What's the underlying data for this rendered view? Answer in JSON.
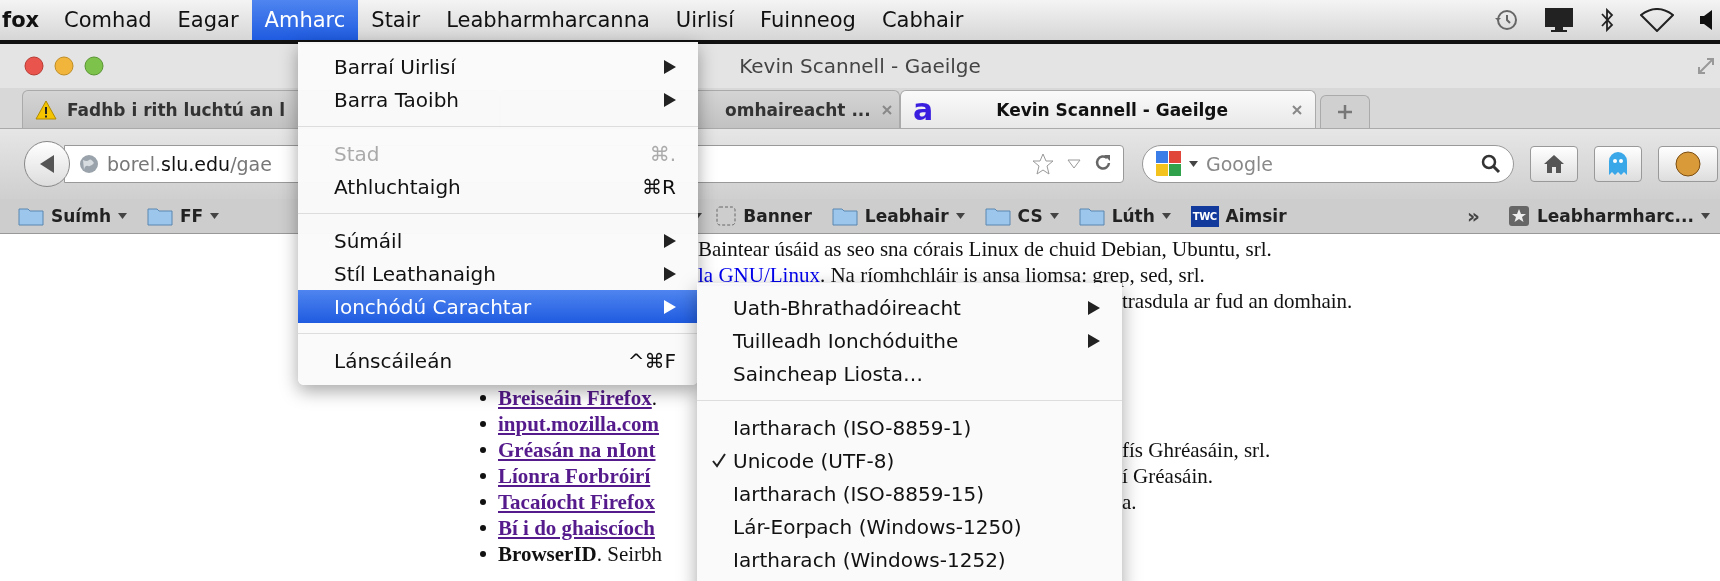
{
  "menubar": {
    "app": "fox",
    "items": [
      {
        "label": "Comhad",
        "selected": false
      },
      {
        "label": "Eagar",
        "selected": false
      },
      {
        "label": "Amharc",
        "selected": true
      },
      {
        "label": "Stair",
        "selected": false
      },
      {
        "label": "Leabharmharcanna",
        "selected": false
      },
      {
        "label": "Uirlisí",
        "selected": false
      },
      {
        "label": "Fuinneog",
        "selected": false
      },
      {
        "label": "Cabhair",
        "selected": false
      }
    ]
  },
  "window": {
    "title": "Kevin Scannell - Gaeilge"
  },
  "tabs": [
    {
      "kind": "warning",
      "label": "Fadhb i rith luchtú an l",
      "selected": false
    },
    {
      "kind": "plain",
      "label": "omhaireacht ...",
      "selected": false,
      "close_button": true
    },
    {
      "kind": "favicon",
      "favicon": "a",
      "label": "Kevin Scannell - Gaeilge",
      "selected": true,
      "close_button": true
    }
  ],
  "toolbar": {
    "url": "borel.**slu.edu**/gae",
    "search_placeholder": "Google"
  },
  "bookmarks": [
    {
      "kind": "folder",
      "label": "Suímh"
    },
    {
      "kind": "folder",
      "label": "FF"
    },
    {
      "kind": "caret"
    },
    {
      "kind": "placeholder",
      "label": "Banner"
    },
    {
      "kind": "folder",
      "label": "Leabhair"
    },
    {
      "kind": "folder",
      "label": "CS"
    },
    {
      "kind": "folder",
      "label": "Lúth"
    },
    {
      "kind": "site",
      "badge": "TWC",
      "label": "Aimsir"
    }
  ],
  "bookmarks_overflow": "»",
  "bookmarks_menu": {
    "label": "Leabharmharc..."
  },
  "page": {
    "intro": [
      {
        "text": "Baintear úsáid as seo sna córais Linux de chuid Debian, Ubuntu, srl."
      },
      {
        "link": "la GNU/Linux",
        "text": ". Na ríomhchláir is ansa liomsa: grep, sed, srl."
      },
      {
        "tail": "trasdula ar fud an domhain."
      }
    ],
    "list": [
      {
        "kind": "link",
        "link": "Breiseáin Firefox",
        "text": "."
      },
      {
        "kind": "link",
        "link": "input.mozilla.com"
      },
      {
        "kind": "link",
        "link": "Gréasán na nIont",
        "tail": "fís Ghréasáin, srl."
      },
      {
        "kind": "link",
        "link": "Líonra Forbróirí",
        "tail": "í Gréasáin."
      },
      {
        "kind": "link",
        "link": "Tacaíocht Firefox",
        "tail": "a."
      },
      {
        "kind": "link",
        "link": "Bí i do ghaiscíoch"
      },
      {
        "kind": "text",
        "text": "**BrowserID**. Seirbh"
      }
    ]
  },
  "menu": {
    "items": [
      {
        "kind": "item",
        "label": "Barraí Uirlisí",
        "submenu": true,
        "disabled": false,
        "selected": false
      },
      {
        "kind": "item",
        "label": "Barra Taoibh",
        "submenu": true,
        "disabled": false,
        "selected": false
      },
      {
        "kind": "separator"
      },
      {
        "kind": "item",
        "label": "Stad",
        "shortcut": "⌘.",
        "submenu": false,
        "disabled": true,
        "selected": false
      },
      {
        "kind": "item",
        "label": "Athluchtaigh",
        "shortcut": "⌘R",
        "submenu": false,
        "disabled": false,
        "selected": false
      },
      {
        "kind": "separator"
      },
      {
        "kind": "item",
        "label": "Súmáil",
        "submenu": true,
        "disabled": false,
        "selected": false
      },
      {
        "kind": "item",
        "label": "Stíl Leathanaigh",
        "submenu": true,
        "disabled": false,
        "selected": false
      },
      {
        "kind": "item",
        "label": "Ionchódú Carachtar",
        "submenu": true,
        "disabled": false,
        "selected": true
      },
      {
        "kind": "separator"
      },
      {
        "kind": "item",
        "label": "Lánscáileán",
        "shortcut": "^⌘F",
        "submenu": false,
        "disabled": false,
        "selected": false
      }
    ]
  },
  "submenu": {
    "items": [
      {
        "kind": "item",
        "label": "Uath-Bhrathadóireacht",
        "submenu": true,
        "checked": false
      },
      {
        "kind": "item",
        "label": "Tuilleadh Ionchóduithe",
        "submenu": true,
        "checked": false
      },
      {
        "kind": "item",
        "label": "Saincheap Liosta…",
        "submenu": false,
        "checked": false
      },
      {
        "kind": "separator"
      },
      {
        "kind": "item",
        "label": "Iartharach (ISO-8859-1)",
        "submenu": false,
        "checked": false
      },
      {
        "kind": "item",
        "label": "Unicode (UTF-8)",
        "submenu": false,
        "checked": true
      },
      {
        "kind": "item",
        "label": "Iartharach (ISO-8859-15)",
        "submenu": false,
        "checked": false
      },
      {
        "kind": "item",
        "label": "Lár-Eorpach (Windows-1250)",
        "submenu": false,
        "checked": false
      },
      {
        "kind": "item",
        "label": "Iartharach (Windows-1252)",
        "submenu": false,
        "checked": false
      }
    ]
  }
}
